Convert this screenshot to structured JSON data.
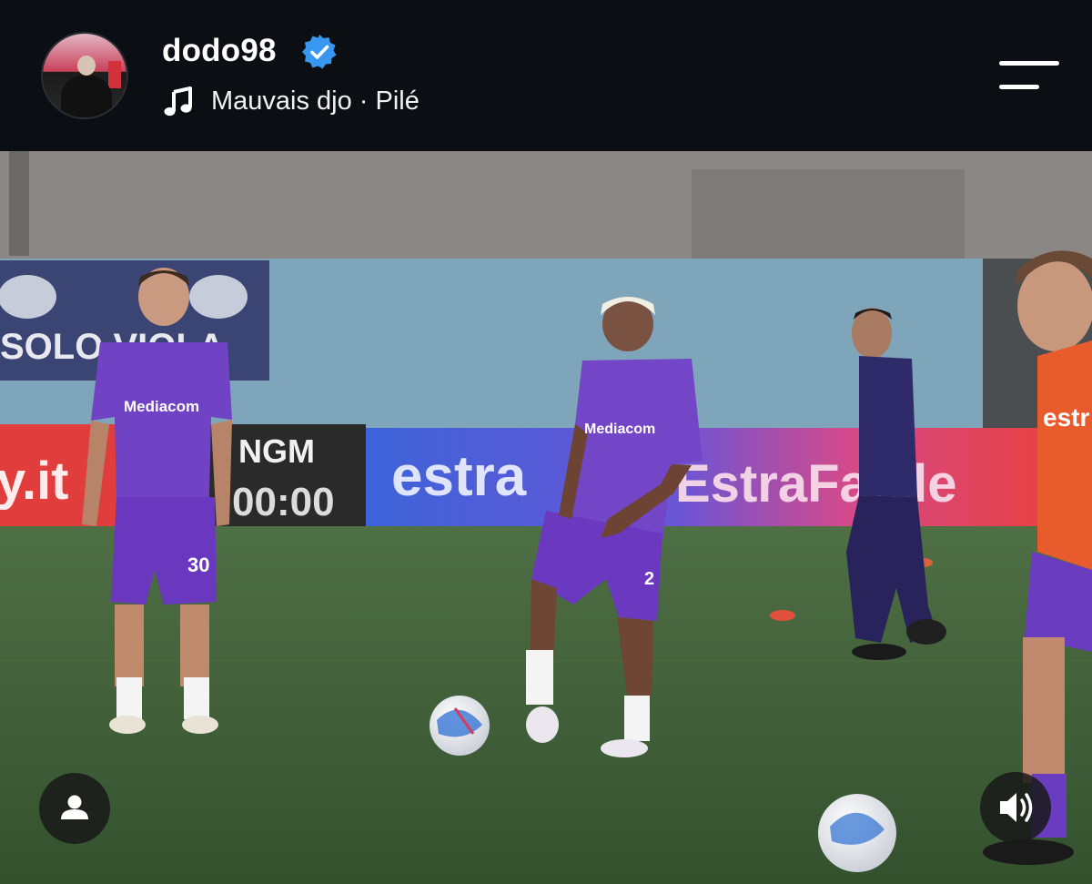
{
  "post": {
    "username": "dodo98",
    "verified": true,
    "track": "Mauvais djo · Pilé"
  },
  "photo": {
    "ad_boards": {
      "left_url_fragment": "y.it",
      "ngm": "NGM",
      "clock": "00:00",
      "estra": "estra",
      "estrafacile": "EstraFacile",
      "banner_top": "SOLO VIOLA"
    },
    "shirt_sponsor": "Mediacom",
    "shirt_numbers": [
      "30",
      "2"
    ],
    "coach_chest_text": "estr"
  },
  "colors": {
    "header_bg": "#0b0e13",
    "verified_blue": "#3897f0",
    "fiorentina_purple": "#6b3fb5",
    "pitch_green": "#3c5a34"
  },
  "icons": [
    "music-note-icon",
    "verified-badge-icon",
    "menu-icon",
    "user-tag-icon",
    "sound-icon"
  ]
}
